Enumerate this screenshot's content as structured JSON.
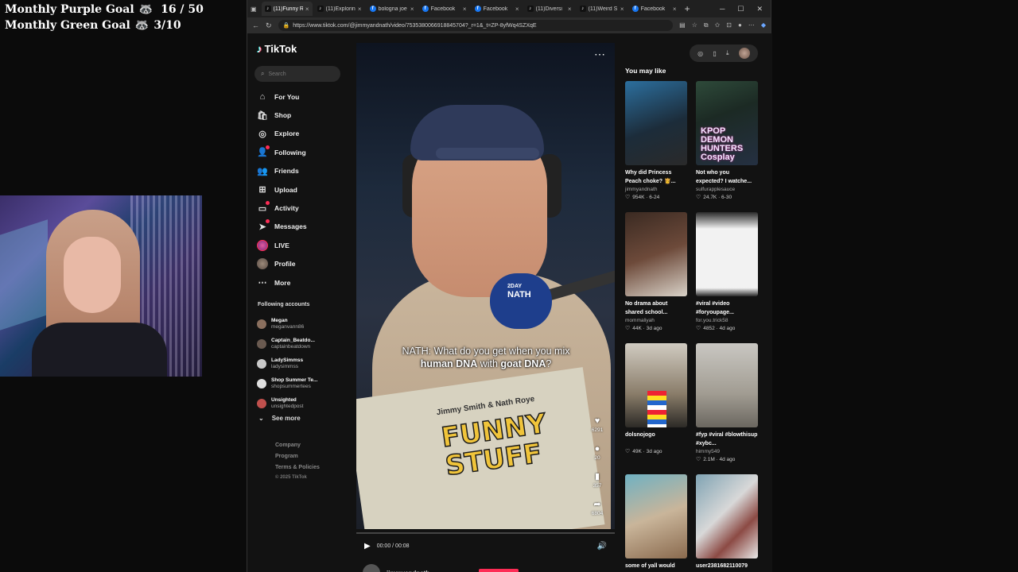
{
  "overlay": {
    "purple_goal_label": "Monthly Purple Goal",
    "purple_goal_value": "16 / 50",
    "green_goal_label": "Monthly Green Goal",
    "green_goal_value": "3/10",
    "goal_icon": "raccoon-icon"
  },
  "browser": {
    "tabs": [
      {
        "label": "(11)Funny R",
        "icon": "tiktok",
        "active": true
      },
      {
        "label": "(11)Explorin",
        "icon": "tiktok",
        "active": false
      },
      {
        "label": "bologna joe",
        "icon": "facebook",
        "active": false
      },
      {
        "label": "Facebook",
        "icon": "facebook",
        "active": false
      },
      {
        "label": "Facebook",
        "icon": "facebook",
        "active": false
      },
      {
        "label": "(11)Diversi",
        "icon": "tiktok",
        "active": false
      },
      {
        "label": "(11)Weird S",
        "icon": "tiktok",
        "active": false
      },
      {
        "label": "Facebook",
        "icon": "facebook",
        "active": false
      }
    ],
    "url": "https://www.tiktok.com/@jimmyandnath/video/7535380066918845704?_r=1&_t=ZP-8yfWq4SZXqE"
  },
  "tiktok": {
    "logo": "TikTok",
    "search_placeholder": "Search",
    "nav": [
      {
        "label": "For You",
        "icon": "home-icon"
      },
      {
        "label": "Shop",
        "icon": "shop-icon"
      },
      {
        "label": "Explore",
        "icon": "compass-icon"
      },
      {
        "label": "Following",
        "icon": "following-icon"
      },
      {
        "label": "Friends",
        "icon": "friends-icon"
      },
      {
        "label": "Upload",
        "icon": "upload-icon"
      },
      {
        "label": "Activity",
        "icon": "activity-icon"
      },
      {
        "label": "Messages",
        "icon": "messages-icon"
      },
      {
        "label": "LIVE",
        "icon": "live-icon"
      },
      {
        "label": "Profile",
        "icon": "profile-icon"
      },
      {
        "label": "More",
        "icon": "more-icon"
      }
    ],
    "following_title": "Following accounts",
    "accounts": [
      {
        "name": "Megan",
        "handle": "meganvann86"
      },
      {
        "name": "Captain_Beatdo...",
        "handle": "captainbeatdown"
      },
      {
        "name": "LadySimmss",
        "handle": "ladysimmss"
      },
      {
        "name": "Shop Summer Te...",
        "handle": "shopsummertees"
      },
      {
        "name": "Unsighted",
        "handle": "unsightedpost"
      }
    ],
    "see_more": "See more",
    "footer": {
      "company": "Company",
      "program": "Program",
      "terms": "Terms & Policies",
      "copyright": "© 2025 TikTok"
    }
  },
  "video": {
    "caption_prefix": "NATH: What do you get when you mix ",
    "caption_bold1": "human DNA",
    "caption_mid": " with ",
    "caption_bold2": "goat DNA",
    "caption_suffix": "?",
    "mic_label_top": "2DAY",
    "mic_label_bottom": "NATH",
    "book_authors": "Jimmy Smith & Nath Roye",
    "book_title": "FUNNY STUFF",
    "likes": "6291",
    "comments": "20",
    "saves": "357",
    "shares": "6804",
    "time": "00:00 / 00:08",
    "progress": 0,
    "author": "jimmyandnath"
  },
  "recommendations": {
    "title": "You may like",
    "items": [
      {
        "title": "Why did Princess Peach choke? 👸...",
        "user": "jimmyandnath",
        "stats": "954K · 6-24"
      },
      {
        "title": "Not who you expected? I watche...",
        "user": "sulfurapplesauce",
        "stats": "24.7K · 6-30"
      },
      {
        "title": "No drama about shared school...",
        "user": "mommaliyah",
        "stats": "44K · 3d ago"
      },
      {
        "title": "#viral #video #foryoupage...",
        "user": "for.you.trick58",
        "stats": "4852 · 4d ago"
      },
      {
        "title": "dolsnojogo",
        "user": "",
        "stats": "49K · 3d ago"
      },
      {
        "title": "#fyp #viral #blowthisup #xybc...",
        "user": "himmy549",
        "stats": "2.1M · 4d ago"
      },
      {
        "title": "some of yall would",
        "user": "",
        "stats": ""
      },
      {
        "title": "user2381682110079",
        "user": "",
        "stats": ""
      }
    ],
    "thumb_text": "KPOP DEMON HUNTERS Cosplay"
  }
}
